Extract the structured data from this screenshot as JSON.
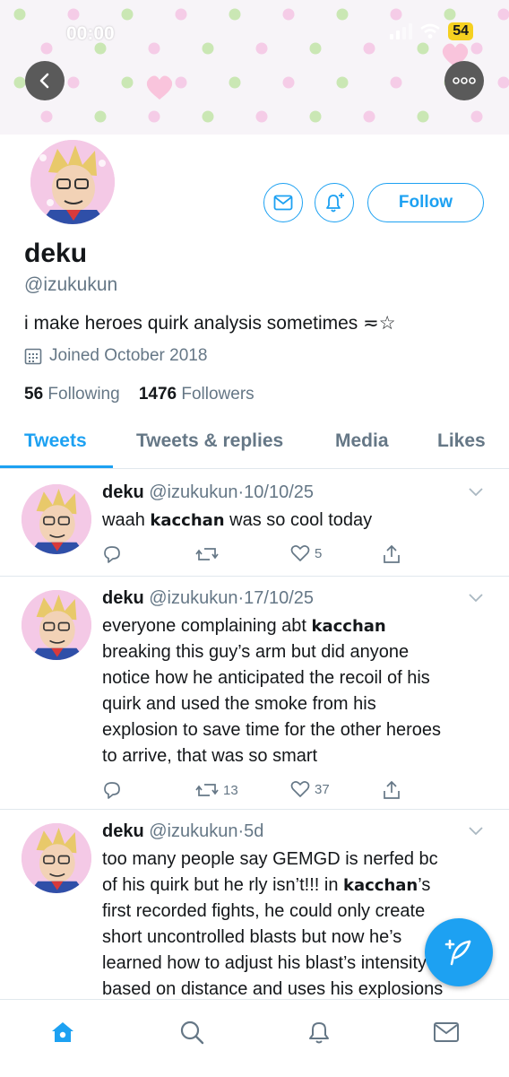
{
  "status_bar": {
    "time": "00:00",
    "battery": "54"
  },
  "profile": {
    "display_name": "deku",
    "handle": "@izukukun",
    "bio": "i make heroes quirk analysis sometimes ≂☆",
    "joined": "Joined October 2018",
    "following_count": "56",
    "following_label": "Following",
    "followers_count": "1476",
    "followers_label": "Followers",
    "follow_button": "Follow"
  },
  "tabs": [
    {
      "label": "Tweets",
      "active": true
    },
    {
      "label": "Tweets & replies",
      "active": false
    },
    {
      "label": "Media",
      "active": false
    },
    {
      "label": "Likes",
      "active": false
    }
  ],
  "tweets": [
    {
      "name": "deku",
      "handle": "@izukukun",
      "date": "10/10/25",
      "lines": [
        "waah <b>kacchan</b> was so cool today"
      ],
      "retweets": "",
      "likes": "5"
    },
    {
      "name": "deku",
      "handle": "@izukukun",
      "date": "17/10/25",
      "lines": [
        "everyone complaining abt <b>kacchan</b>",
        "breaking this guy’s arm but did anyone",
        "notice how he anticipated the recoil of his",
        "quirk and used the smoke from his",
        "explosion to save time for the other heroes",
        "to arrive, that was so smart"
      ],
      "retweets": "13",
      "likes": "37"
    },
    {
      "name": "deku",
      "handle": "@izukukun",
      "date": "5d",
      "lines": [
        "too many people say GEMGD is nerfed bc",
        "of his quirk but he rly isn’t!!! in <b>kacchan</b>’s",
        "first recorded fights, he could only create",
        "short uncontrolled blasts but now he’s",
        "learned how to adjust his blast’s intensity",
        "based on distance and uses his explosions"
      ],
      "retweets": "",
      "likes": ""
    }
  ],
  "colors": {
    "accent": "#1da1f2",
    "muted": "#657786",
    "text": "#14171a",
    "banner_pink": "#f4c9e6",
    "banner_green": "#c7e6b0"
  },
  "icons": {
    "back": "chevron-left-icon",
    "more": "more-dots-icon",
    "message": "envelope-icon",
    "notify": "bell-plus-icon",
    "calendar": "calendar-icon",
    "reply": "reply-icon",
    "retweet": "retweet-icon",
    "like": "heart-icon",
    "share": "share-icon",
    "compose": "feather-plus-icon",
    "home": "home-icon",
    "search": "search-icon",
    "notifications": "bell-icon",
    "messages": "envelope-icon"
  }
}
